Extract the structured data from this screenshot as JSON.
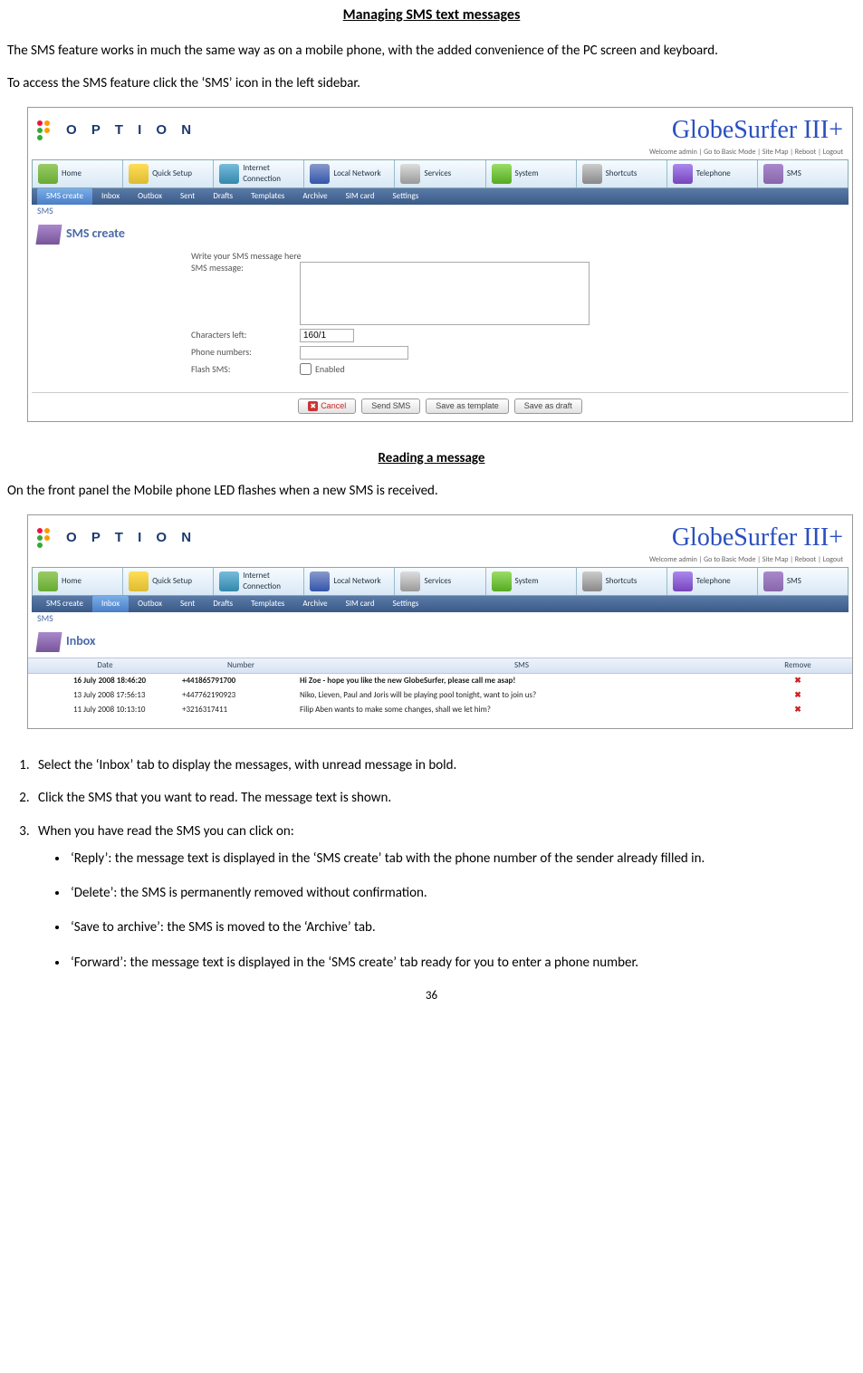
{
  "title": "Managing SMS text messages",
  "intro1": "The SMS feature works in much the same way as on a mobile phone, with the added convenience of the PC screen and keyboard.",
  "intro2": "To access the SMS feature click the ‘SMS’ icon in the left sidebar.",
  "subhead": "Reading a message",
  "reading_intro": "On the front panel the Mobile phone LED flashes when a new SMS is received.",
  "steps": {
    "s1": "Select the ‘Inbox’ tab to display the messages, with unread message in bold.",
    "s2": "Click the SMS that you want to read. The message text is shown.",
    "s3": "When you have read the SMS you can click on:"
  },
  "bullets": {
    "b1": "‘Reply’: the message text is displayed in the ‘SMS create’ tab with the phone number of the sender already filled in.",
    "b2": "‘Delete’: the SMS is permanently removed without confirmation.",
    "b3": "‘Save to archive’: the SMS is moved to the ‘Archive’ tab.",
    "b4": "‘Forward’: the message text is displayed in the ‘SMS create’ tab ready for you to enter a phone number."
  },
  "page_number": "36",
  "shot": {
    "option_logo": "O P T I O N",
    "brand": "GlobeSurfer III+",
    "topbar": "Welcome admin | Go to Basic Mode |  Site Map |  Reboot |  Logout",
    "nav": [
      "Home",
      "Quick Setup",
      "Internet Connection",
      "Local Network",
      "Services",
      "System",
      "Shortcuts",
      "Telephone",
      "SMS"
    ],
    "subnav_create": [
      "SMS create",
      "Inbox",
      "Outbox",
      "Sent",
      "Drafts",
      "Templates",
      "Archive",
      "SIM card",
      "Settings"
    ],
    "subnav_inbox": [
      "SMS create",
      "Inbox",
      "Outbox",
      "Sent",
      "Drafts",
      "Templates",
      "Archive",
      "SIM card",
      "Settings"
    ],
    "section_label_sms": "SMS",
    "panel_create_title": "SMS create",
    "panel_inbox_title": "Inbox",
    "create": {
      "write_hint": "Write your SMS message here",
      "sms_message": "SMS message:",
      "chars_left": "Characters left:",
      "chars_value": "160/1",
      "phone_numbers": "Phone numbers:",
      "flash_sms": "Flash SMS:",
      "enabled": "Enabled",
      "buttons": {
        "cancel": "Cancel",
        "send": "Send SMS",
        "tpl": "Save as template",
        "draft": "Save as draft"
      }
    },
    "inbox": {
      "headers": {
        "date": "Date",
        "number": "Number",
        "sms": "SMS",
        "remove": "Remove"
      },
      "rows": [
        {
          "date": "16 July 2008  18:46:20",
          "number": "+441865791700",
          "sms": "Hi Zoe - hope you like the new GlobeSurfer, please call me asap!",
          "bold": true
        },
        {
          "date": "13 July 2008  17:56:13",
          "number": "+447762190923",
          "sms": "Niko, Lieven, Paul and Joris will be playing pool tonight, want to join us?",
          "bold": false
        },
        {
          "date": "11 July 2008  10:13:10",
          "number": "+3216317411",
          "sms": "Filip Aben wants to make some changes, shall we let him?",
          "bold": false
        }
      ]
    }
  }
}
